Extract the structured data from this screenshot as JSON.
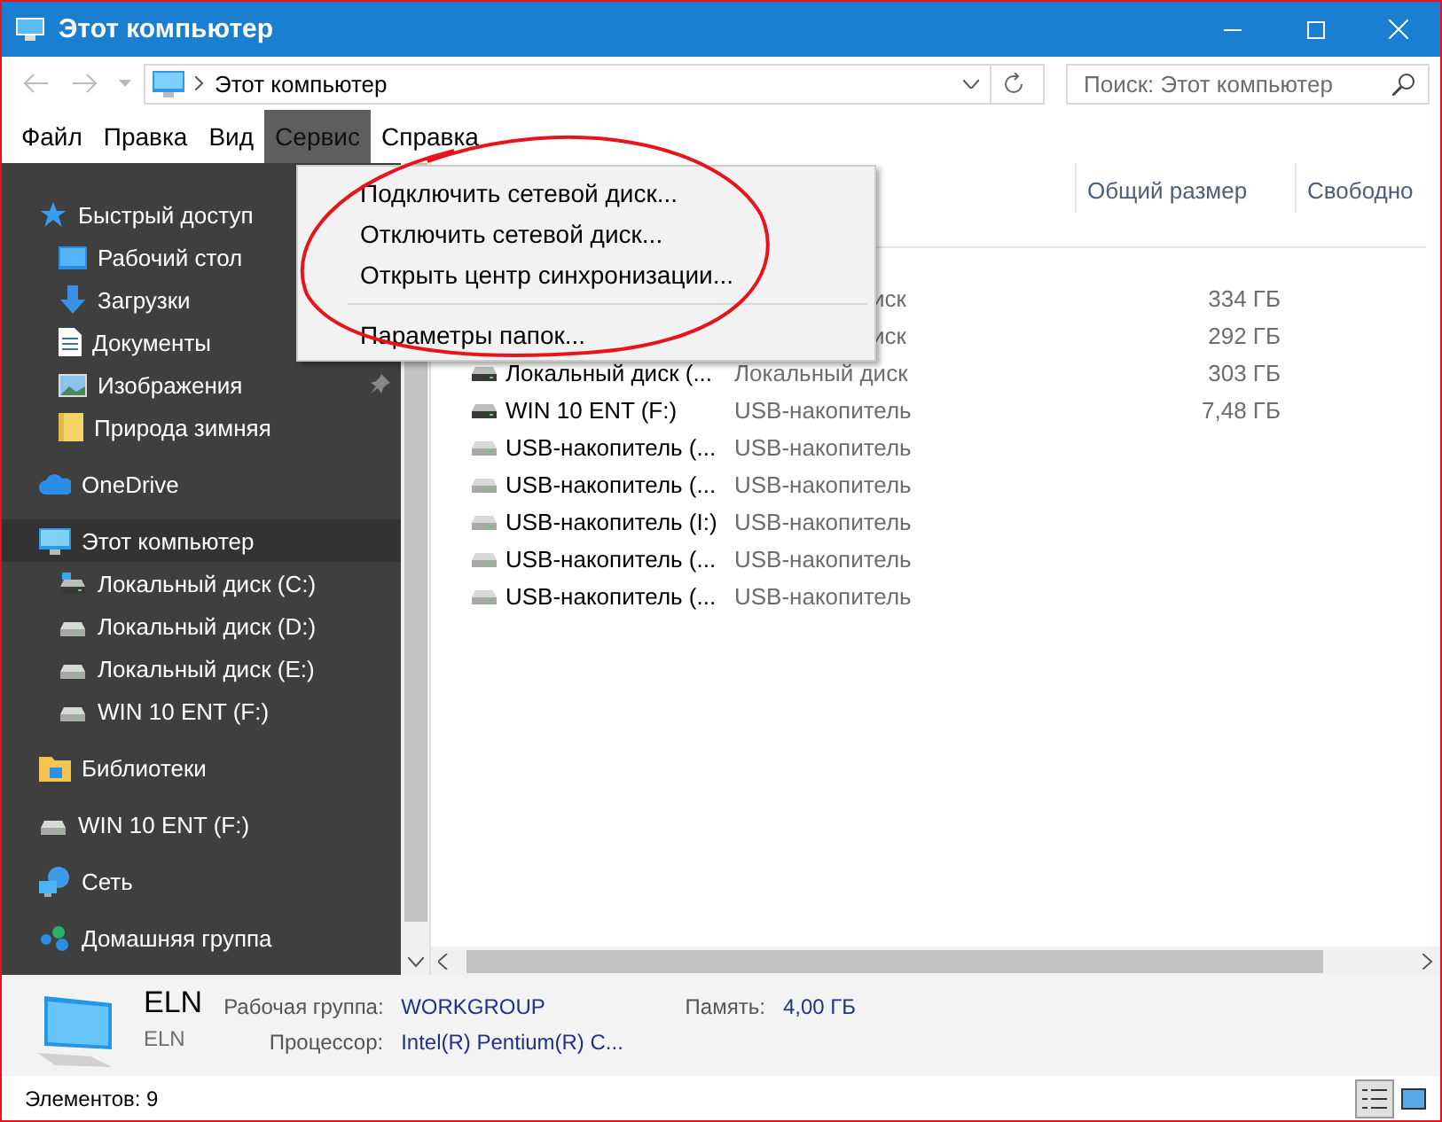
{
  "window": {
    "title": "Этот компьютер"
  },
  "address_bar": {
    "path": "Этот компьютер"
  },
  "search": {
    "placeholder": "Поиск: Этот компьютер"
  },
  "menu_bar": [
    {
      "label": "Файл",
      "selected": false
    },
    {
      "label": "Правка",
      "selected": false
    },
    {
      "label": "Вид",
      "selected": false
    },
    {
      "label": "Сервис",
      "selected": true
    },
    {
      "label": "Справка",
      "selected": false
    }
  ],
  "dropdown_menu": [
    {
      "kind": "item",
      "label": "Подключить сетевой диск..."
    },
    {
      "kind": "item",
      "label": "Отключить сетевой диск..."
    },
    {
      "kind": "item",
      "label": "Открыть центр синхронизации..."
    },
    {
      "kind": "separator"
    },
    {
      "kind": "item",
      "label": "Параметры папок..."
    }
  ],
  "sidebar": {
    "items": [
      {
        "label": "Быстрый доступ",
        "kind": "star",
        "selected": false,
        "children": [
          {
            "label": "Рабочий стол",
            "kind": "desktop",
            "selected": false,
            "pinned": false
          },
          {
            "label": "Загрузки",
            "kind": "download",
            "selected": false,
            "pinned": false
          },
          {
            "label": "Документы",
            "kind": "document",
            "selected": false,
            "pinned": false
          },
          {
            "label": "Изображения",
            "kind": "image",
            "selected": false,
            "pinned": true
          },
          {
            "label": "Природа зимняя",
            "kind": "folder",
            "selected": false,
            "pinned": false
          }
        ]
      },
      {
        "label": "OneDrive",
        "kind": "cloud",
        "selected": false
      },
      {
        "label": "Этот компьютер",
        "kind": "computer",
        "selected": true,
        "children": [
          {
            "label": "Локальный диск (C:)",
            "kind": "system-drive",
            "selected": false
          },
          {
            "label": "Локальный диск (D:)",
            "kind": "drive",
            "selected": false
          },
          {
            "label": "Локальный диск (E:)",
            "kind": "drive",
            "selected": false
          },
          {
            "label": "WIN 10 ENT (F:)",
            "kind": "drive",
            "selected": false
          }
        ]
      },
      {
        "label": "Библиотеки",
        "kind": "library",
        "selected": false
      },
      {
        "label": "WIN 10 ENT (F:)",
        "kind": "drive",
        "selected": false
      },
      {
        "label": "Сеть",
        "kind": "network",
        "selected": false
      },
      {
        "label": "Домашняя группа",
        "kind": "homegroup",
        "selected": false
      }
    ]
  },
  "table": {
    "columns": [
      {
        "label": "Общий размер"
      },
      {
        "label": "Свободно"
      }
    ],
    "rows": [
      {
        "type": "иск",
        "size": "334 ГБ"
      },
      {
        "type": "иск",
        "size": "292 ГБ"
      },
      {
        "kind": "local",
        "name": "Локальный диск (...",
        "type": "Локальный диск",
        "size": "303 ГБ"
      },
      {
        "kind": "local",
        "name": "WIN 10 ENT (F:)",
        "type": "USB-накопитель",
        "size": "7,48 ГБ"
      },
      {
        "kind": "usb",
        "name": "USB-накопитель (...",
        "type": "USB-накопитель"
      },
      {
        "kind": "usb",
        "name": "USB-накопитель (...",
        "type": "USB-накопитель"
      },
      {
        "kind": "usb",
        "name": "USB-накопитель (I:)",
        "type": "USB-накопитель"
      },
      {
        "kind": "usb",
        "name": "USB-накопитель (...",
        "type": "USB-накопитель"
      },
      {
        "kind": "usb",
        "name": "USB-накопитель (...",
        "type": "USB-накопитель"
      }
    ]
  },
  "details": {
    "name": "ELN",
    "subtitle": "ELN",
    "fields": [
      {
        "label": "Рабочая группа:",
        "value": "WORKGROUP"
      },
      {
        "label": "Память:",
        "value": "4,00 ГБ"
      },
      {
        "label": "Процессор:",
        "value": "Intel(R) Pentium(R) C..."
      }
    ]
  },
  "status_bar": {
    "count": "Элементов: 9",
    "views": [
      {
        "kind": "details",
        "selected": true
      },
      {
        "kind": "tiles",
        "selected": false
      }
    ]
  }
}
